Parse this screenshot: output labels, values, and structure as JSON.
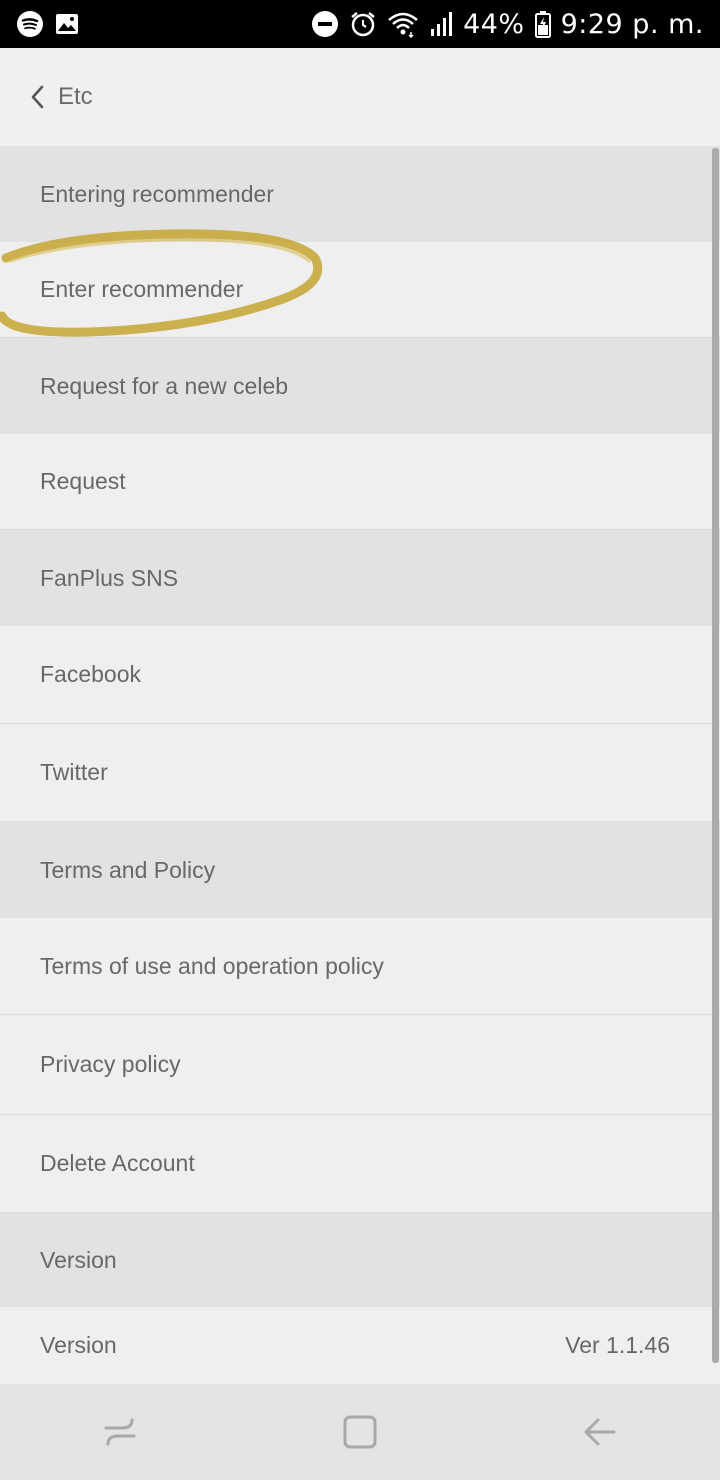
{
  "status_bar": {
    "left_icons": [
      "spotify-icon",
      "image-icon"
    ],
    "right_icons": [
      "do-not-disturb-icon",
      "alarm-icon",
      "wifi-icon",
      "signal-icon",
      "battery-icon"
    ],
    "battery": "44%",
    "time": "9:29 p. m."
  },
  "header": {
    "back_icon": "chevron-left-icon",
    "title": "Etc"
  },
  "list": {
    "rows": [
      {
        "type": "section",
        "label": "Entering recommender"
      },
      {
        "type": "item",
        "label": "Enter recommender"
      },
      {
        "type": "section",
        "label": "Request for a new celeb"
      },
      {
        "type": "item",
        "label": "Request"
      },
      {
        "type": "section",
        "label": "FanPlus SNS"
      },
      {
        "type": "item",
        "label": "Facebook"
      },
      {
        "type": "item",
        "label": "Twitter"
      },
      {
        "type": "section",
        "label": "Terms and Policy"
      },
      {
        "type": "item",
        "label": "Terms of use and operation policy"
      },
      {
        "type": "item",
        "label": "Privacy policy"
      },
      {
        "type": "item",
        "label": "Delete Account"
      },
      {
        "type": "section",
        "label": "Version"
      },
      {
        "type": "item",
        "label": "Version",
        "value": "Ver 1.1.46"
      }
    ]
  },
  "annotation": {
    "shape": "hand-drawn-ellipse",
    "color": "#c9a93c",
    "target": "Enter recommender"
  },
  "nav_bar": {
    "buttons": [
      "recent-apps-icon",
      "home-icon",
      "back-icon"
    ]
  },
  "colors": {
    "status_bar_bg": "#000000",
    "section_bg": "#e2e2e2",
    "item_bg": "#efefef",
    "text": "#686868"
  }
}
